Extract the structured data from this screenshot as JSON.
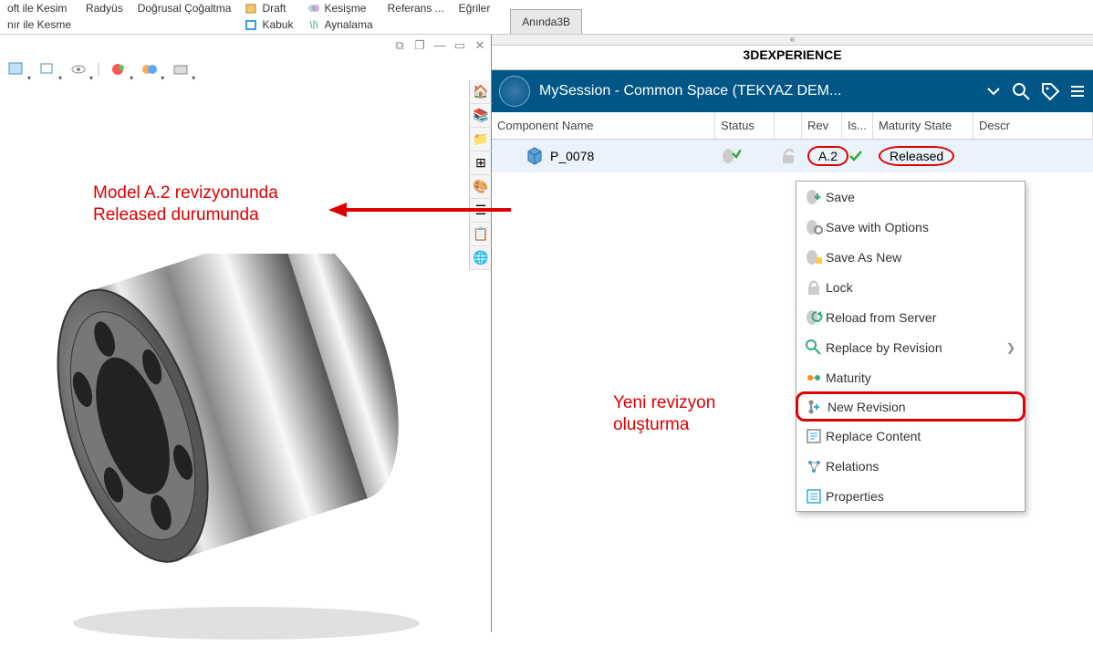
{
  "ribbon": {
    "left1": "oft ile Kesim",
    "left2": "nır ile Kesme",
    "radyus": "Radyüs",
    "dcog": "Doğrusal Çoğaltma",
    "draft": "Draft",
    "kabuk": "Kabuk",
    "kesisme": "Kesişme",
    "aynalama": "Aynalama",
    "referans": "Referans ...",
    "egriler": "Eğriler",
    "aninda": "Anında3B"
  },
  "window_controls": {
    "pop": "⧉",
    "dup": "❐",
    "min": "—",
    "max": "▭",
    "close": "✕"
  },
  "panel": {
    "title": "3DEXPERIENCE",
    "session": "MySession - Common Space (TEKYAZ DEM..."
  },
  "columns": {
    "name": "Component Name",
    "status": "Status",
    "rev": "Rev",
    "is": "Is...",
    "maturity": "Maturity State",
    "descr": "Descr"
  },
  "row": {
    "name": "P_0078",
    "rev": "A.2",
    "maturity": "Released"
  },
  "menu": {
    "save": "Save",
    "saveopts": "Save with Options",
    "saveas": "Save As New",
    "lock": "Lock",
    "reload": "Reload from Server",
    "replace_rev": "Replace by Revision",
    "maturity": "Maturity",
    "new_rev": "New Revision",
    "replace_content": "Replace Content",
    "relations": "Relations",
    "properties": "Properties"
  },
  "annotations": {
    "a1": "Model A.2 revizyonunda\nReleased durumunda",
    "a2": "Yeni revizyon\noluşturma"
  }
}
